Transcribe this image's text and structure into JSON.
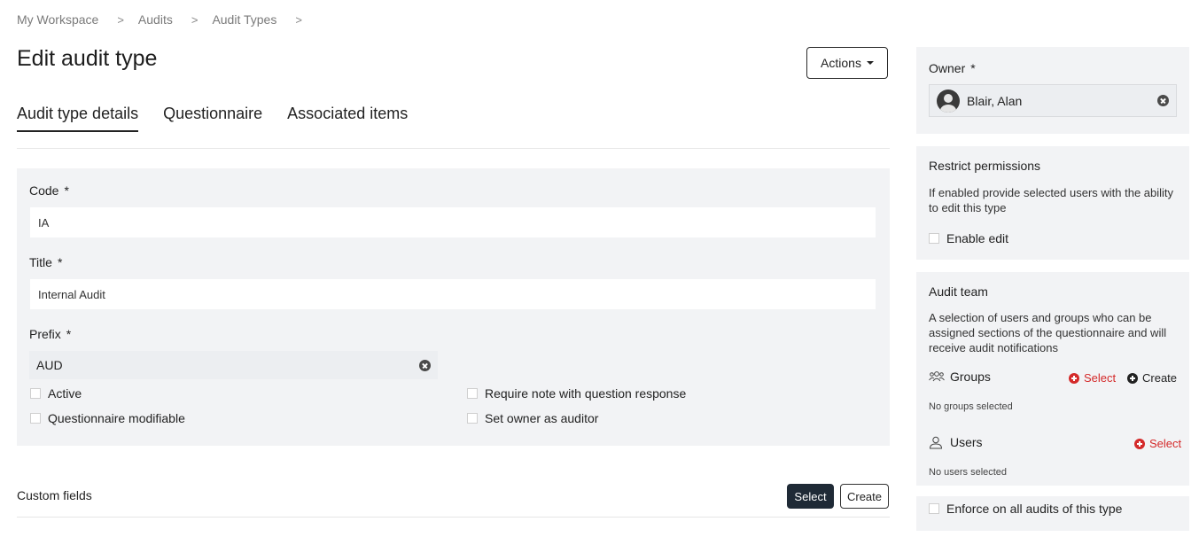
{
  "breadcrumb": [
    "My Workspace",
    "Audits",
    "Audit Types"
  ],
  "breadcrumb_sep": ">",
  "page_title": "Edit audit type",
  "actions_label": "Actions",
  "tabs": [
    {
      "label": "Audit type details",
      "active": true
    },
    {
      "label": "Questionnaire",
      "active": false
    },
    {
      "label": "Associated items",
      "active": false
    }
  ],
  "form": {
    "required_mark": "*",
    "code": {
      "label": "Code",
      "value": "IA"
    },
    "title": {
      "label": "Title",
      "value": "Internal Audit"
    },
    "prefix": {
      "label": "Prefix",
      "value": "AUD"
    },
    "checkboxes": {
      "active": "Active",
      "questionnaire_modifiable": "Questionnaire modifiable",
      "require_note": "Require note with question response",
      "set_owner_auditor": "Set owner as auditor"
    }
  },
  "custom_fields": {
    "label": "Custom fields",
    "select_label": "Select",
    "create_label": "Create"
  },
  "owner": {
    "label": "Owner",
    "required_mark": "*",
    "name": "Blair, Alan"
  },
  "restrict": {
    "title": "Restrict permissions",
    "description": "If enabled provide selected users with the ability to edit this type",
    "enable_edit_label": "Enable edit"
  },
  "audit_team": {
    "title": "Audit team",
    "description": "A selection of users and groups who can be assigned sections of the questionnaire and will receive audit notifications",
    "groups_label": "Groups",
    "groups_select": "Select",
    "groups_create": "Create",
    "no_groups": "No groups selected",
    "users_label": "Users",
    "users_select": "Select",
    "no_users": "No users selected",
    "enforce_label": "Enforce on all audits of this type"
  },
  "colors": {
    "accent_red": "#d42a2a",
    "dark_button": "#1f2a36",
    "panel_bg": "#f2f3f5"
  }
}
